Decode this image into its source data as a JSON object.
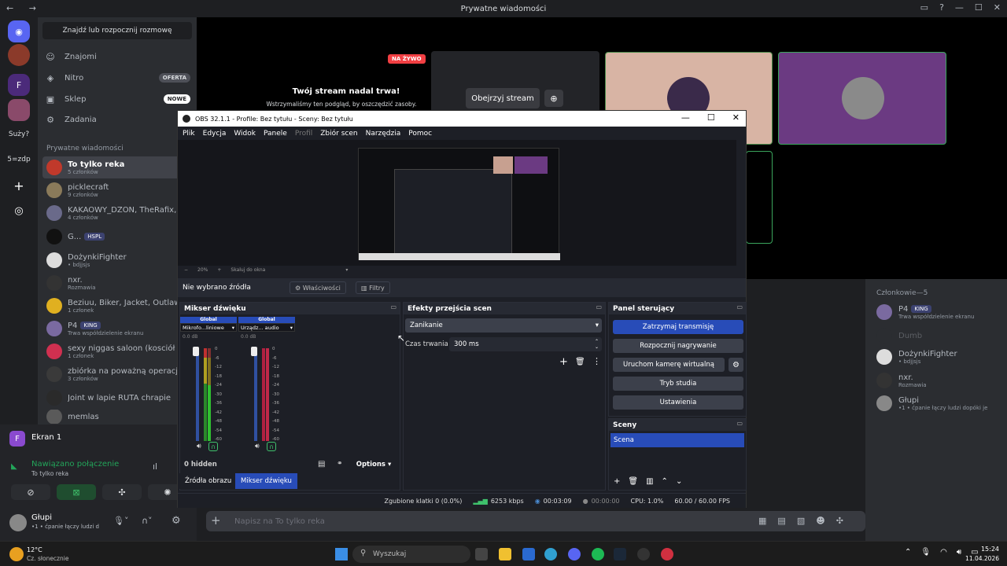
{
  "discord": {
    "title": "Prywatne wiadomości",
    "rail_labels": [
      "Suży?",
      "5=zdp"
    ],
    "find_placeholder": "Znajdź lub rozpocznij rozmowę",
    "nav": [
      {
        "label": "Znajomi",
        "icon": "friends-icon"
      },
      {
        "label": "Nitro",
        "icon": "nitro-icon",
        "badge": "OFERTA"
      },
      {
        "label": "Sklep",
        "icon": "shop-icon",
        "badge": "NOWE"
      },
      {
        "label": "Zadania",
        "icon": "quests-icon"
      }
    ],
    "dm_header": "Prywatne wiadomości",
    "dms": [
      {
        "name": "To tylko reka",
        "sub": "5 członków",
        "color": "#c0392b"
      },
      {
        "name": "picklecraft",
        "sub": "9 członków",
        "color": "#8a7a5a"
      },
      {
        "name": "KAKAOWY_DŻON, TheRafix, G",
        "sub": "4 członków",
        "color": "#6a6a8a"
      },
      {
        "name": "G...",
        "sub": "",
        "tag": "HSPL",
        "color": "#111111"
      },
      {
        "name": "DożynkiFighter",
        "sub": "• bdjjsjs",
        "color": "#dddddd"
      },
      {
        "name": "nxr.",
        "sub": "Rozmawia",
        "color": "#333333"
      },
      {
        "name": "Beziuu, Biker, Jacket, Outlaw",
        "sub": "1 członek",
        "color": "#e0b020"
      },
      {
        "name": "P4",
        "sub": "Trwa współdzielenie ekranu",
        "tag": "KING",
        "color": "#7a6aa0"
      },
      {
        "name": "sexy niggas saloon (kosciół skl",
        "sub": "1 członek",
        "color": "#d03050"
      },
      {
        "name": "zbiórka na poważną operacje r",
        "sub": "3 członków",
        "color": "#3a3a3a"
      },
      {
        "name": "Joint w lapie RUTA chrapie",
        "sub": "",
        "color": "#2a2a2a"
      },
      {
        "name": "memlas",
        "sub": "",
        "color": "#5a5a5a"
      }
    ],
    "voice": {
      "channel": "Ekran 1",
      "status": "Nawiązano połączenie",
      "server": "To tylko reka"
    },
    "user": {
      "name": "Głupi",
      "status": "•1 • ćpanie łączy ludzi d"
    },
    "stream": {
      "live_badge": "NA ŻYWO",
      "title": "Twój stream nadal trwa!",
      "subtitle": "Wstrzymaliśmy ten podgląd, by oszczędzić zasoby.",
      "watch_button": "Obejrzyj stream"
    },
    "members_header": "Członkowie—5",
    "members": [
      {
        "name": "P4",
        "tag": "KING",
        "sub": "Trwa współdzielenie ekranu",
        "color": "#7a6aa0"
      },
      {
        "name": "Dumb",
        "sub": "",
        "color": "#2b2d31",
        "dim": true
      },
      {
        "name": "DożynkiFighter",
        "sub": "• bdjjsjs",
        "color": "#dddddd"
      },
      {
        "name": "nxr.",
        "sub": "Rozmawia",
        "color": "#333333"
      },
      {
        "name": "Głupi",
        "sub": "•1 • ćpanie łączy ludzi dopóki je",
        "color": "#888888"
      }
    ],
    "chat_placeholder": "Napisz na To tylko reka"
  },
  "obs": {
    "title": "OBS 32.1.1 - Profile: Bez tytułu - Sceny: Bez tytułu",
    "menu": [
      "Plik",
      "Edycja",
      "Widok",
      "Panele",
      "Profil",
      "Zbiór scen",
      "Narzędzia",
      "Pomoc"
    ],
    "zoom": "20%",
    "zoom_mode": "Skaluj do okna",
    "no_source": "Nie wybrano źródła",
    "properties": "Właściwości",
    "filters": "Filtry",
    "mixer": {
      "title": "Mikser dźwięku",
      "channels": [
        {
          "header": "Global",
          "device": "Mikrofo...liniowe",
          "db": "0.0 dB"
        },
        {
          "header": "Global",
          "device": "Urządz... audio",
          "db": "0.0 dB"
        }
      ],
      "ticks": [
        "0",
        "-6",
        "-12",
        "-18",
        "-24",
        "-30",
        "-36",
        "-42",
        "-48",
        "-54",
        "-60"
      ],
      "hidden": "0 hidden",
      "options": "Options"
    },
    "transitions": {
      "title": "Efekty przejścia scen",
      "effect": "Zanikanie",
      "duration_label": "Czas trwania",
      "duration": "300 ms"
    },
    "controls": {
      "title": "Panel sterujący",
      "buttons": [
        "Zatrzymaj transmisję",
        "Rozpocznij nagrywanie",
        "Uruchom kamerę wirtualną",
        "Tryb studia",
        "Ustawienia"
      ]
    },
    "scenes": {
      "title": "Sceny",
      "items": [
        "Scena"
      ]
    },
    "tabs": [
      "Źródła obrazu",
      "Mikser dźwięku"
    ],
    "status": {
      "dropped": "Zgubione klatki 0 (0.0%)",
      "bitrate": "6253 kbps",
      "stream_time": "00:03:09",
      "rec_time": "00:00:00",
      "cpu": "CPU: 1.0%",
      "fps": "60.00 / 60.00 FPS"
    }
  },
  "taskbar": {
    "weather_temp": "12°C",
    "weather_desc": "Cz. słonecznie",
    "search": "Wyszukaj",
    "time": "15:24",
    "date": "11.04.2026"
  }
}
